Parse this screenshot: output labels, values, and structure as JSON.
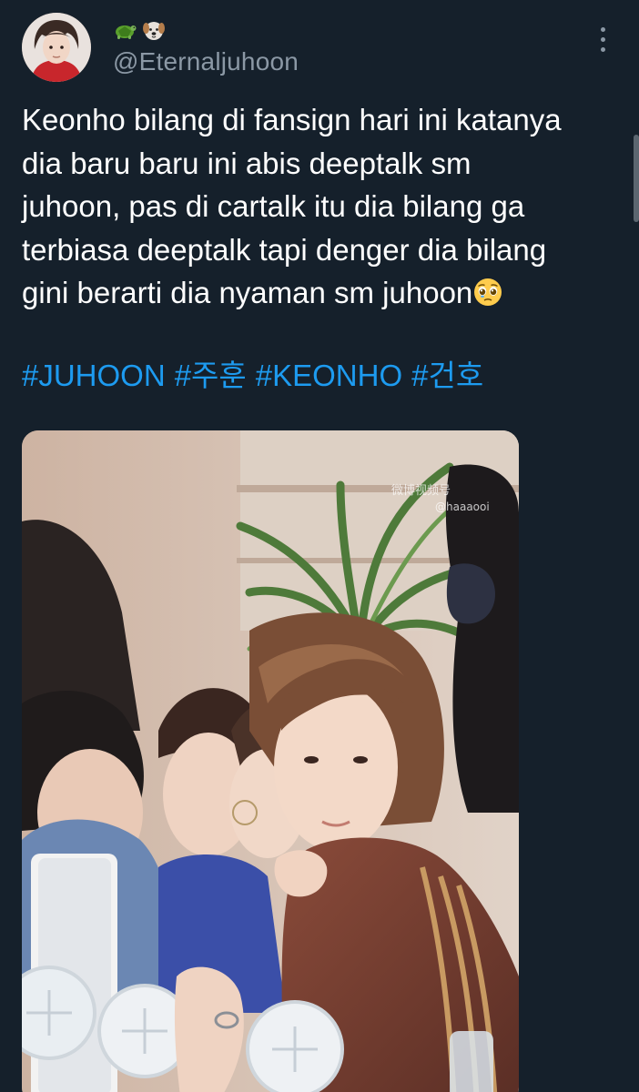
{
  "author": {
    "display_name_emojis": [
      "turtle-emoji",
      "dog-face-emoji"
    ],
    "handle": "@Eternaljuhoon"
  },
  "tweet": {
    "text_lines": [
      "Keonho bilang di fansign hari ini katanya",
      "dia baru baru ini abis deeptalk sm",
      "juhoon, pas di cartalk itu dia bilang ga",
      "terbiasa deeptalk tapi denger dia bilang",
      "gini berarti dia nyaman sm juhoon"
    ],
    "trailing_emoji": "pleading-face-emoji",
    "hashtags": [
      "#JUHOON",
      "#주훈",
      "#KEONHO",
      "#건호"
    ]
  },
  "media": {
    "watermark_line1": "微博视频号",
    "watermark_line2": "@haaaooi"
  },
  "colors": {
    "background": "#15202b",
    "text": "#ffffff",
    "muted": "#8b98a5",
    "link": "#1d9bf0"
  }
}
